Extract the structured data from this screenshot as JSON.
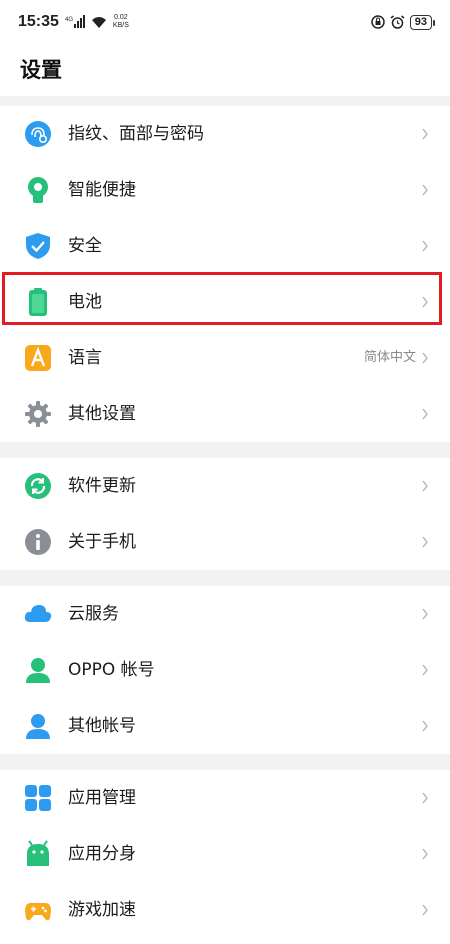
{
  "status_bar": {
    "time": "15:35",
    "signal": "4G",
    "net_speed_value": "0.02",
    "net_speed_unit": "KB/S",
    "battery": "93"
  },
  "header": {
    "title": "设置"
  },
  "settings": {
    "group1": [
      {
        "label": "指纹、面部与密码",
        "icon": "fingerprint-face-icon"
      },
      {
        "label": "智能便捷",
        "icon": "smart-assist-icon"
      },
      {
        "label": "安全",
        "icon": "shield-icon"
      },
      {
        "label": "电池",
        "icon": "battery-icon"
      },
      {
        "label": "语言",
        "icon": "language-icon",
        "value": "简体中文"
      },
      {
        "label": "其他设置",
        "icon": "gear-icon"
      }
    ],
    "group2": [
      {
        "label": "软件更新",
        "icon": "update-icon"
      },
      {
        "label": "关于手机",
        "icon": "info-icon"
      }
    ],
    "group3": [
      {
        "label": "云服务",
        "icon": "cloud-icon"
      },
      {
        "label": "OPPO 帐号",
        "icon": "account-icon"
      },
      {
        "label": "其他帐号",
        "icon": "other-account-icon"
      }
    ],
    "group4": [
      {
        "label": "应用管理",
        "icon": "app-management-icon"
      },
      {
        "label": "应用分身",
        "icon": "app-clone-icon"
      },
      {
        "label": "游戏加速",
        "icon": "game-controller-icon"
      }
    ]
  },
  "colors": {
    "highlight": "#e31b23",
    "section_gap": "#f2f2f2",
    "icon_green": "#27c07a",
    "icon_blue": "#2c9bf0"
  }
}
